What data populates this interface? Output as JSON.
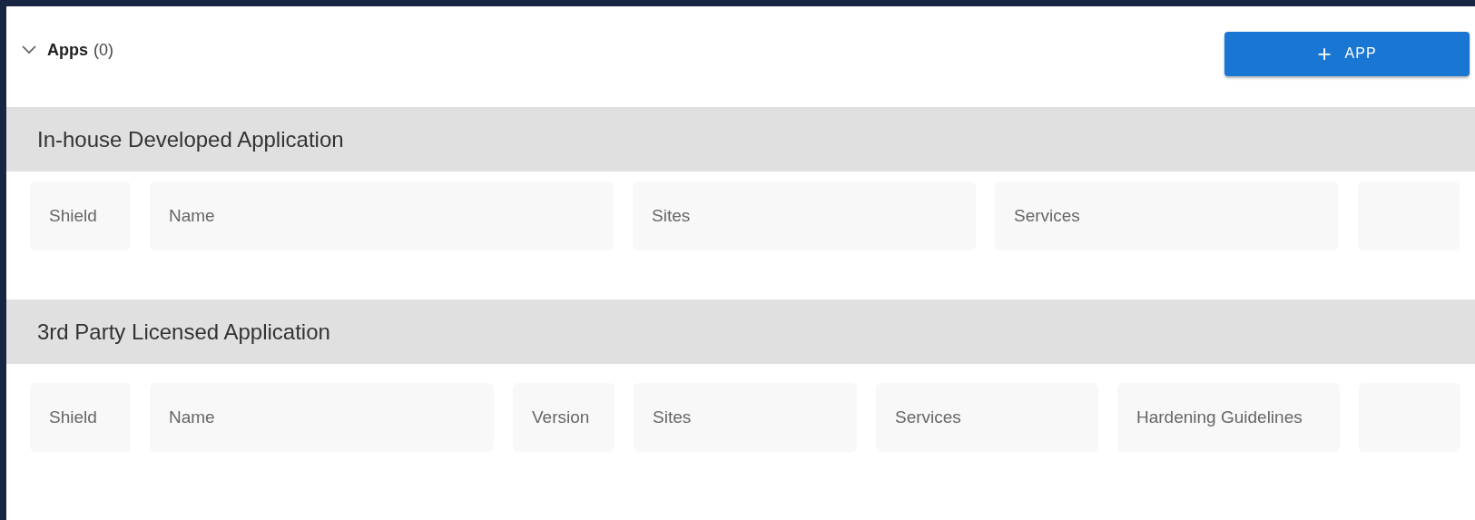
{
  "header": {
    "title": "Apps",
    "count": "(0)",
    "expanded": true
  },
  "add_button": {
    "icon": "+",
    "label": "APP"
  },
  "sections": [
    {
      "title": "In-house Developed Application",
      "columns": [
        "Shield",
        "Name",
        "Sites",
        "Services",
        ""
      ]
    },
    {
      "title": "3rd Party Licensed Application",
      "columns": [
        "Shield",
        "Name",
        "Version",
        "Sites",
        "Services",
        "Hardening Guidelines",
        ""
      ]
    }
  ]
}
